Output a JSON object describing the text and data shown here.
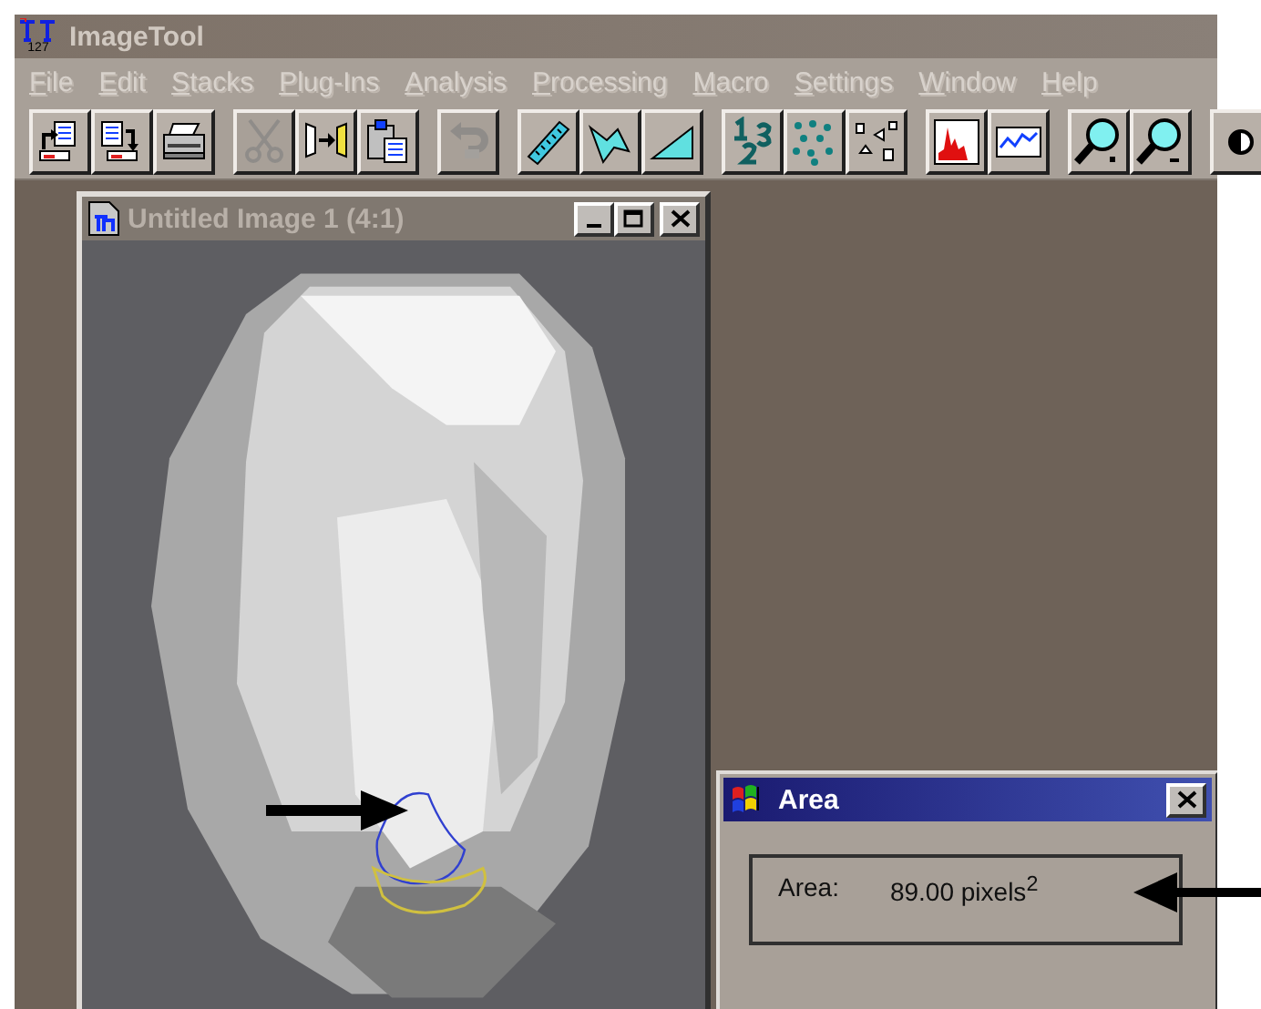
{
  "window": {
    "title": "ImageTool",
    "logo_text": "127"
  },
  "menu": [
    {
      "label": "File"
    },
    {
      "label": "Edit"
    },
    {
      "label": "Stacks"
    },
    {
      "label": "Plug-Ins"
    },
    {
      "label": "Analysis"
    },
    {
      "label": "Processing"
    },
    {
      "label": "Macro"
    },
    {
      "label": "Settings"
    },
    {
      "label": "Window"
    },
    {
      "label": "Help"
    }
  ],
  "toolbar": [
    [
      {
        "kind": "open",
        "disabled": false
      },
      {
        "kind": "save",
        "disabled": false
      },
      {
        "kind": "print",
        "disabled": false
      }
    ],
    [
      {
        "kind": "cut",
        "disabled": true
      },
      {
        "kind": "flip",
        "disabled": false
      },
      {
        "kind": "paste",
        "disabled": false
      }
    ],
    [
      {
        "kind": "undo",
        "disabled": true
      }
    ],
    [
      {
        "kind": "ruler",
        "disabled": false
      },
      {
        "kind": "polygon",
        "disabled": false
      },
      {
        "kind": "triangle",
        "disabled": false
      }
    ],
    [
      {
        "kind": "numbers",
        "disabled": false
      },
      {
        "kind": "dots",
        "disabled": false
      },
      {
        "kind": "particles",
        "disabled": false
      }
    ],
    [
      {
        "kind": "histogram",
        "disabled": false
      },
      {
        "kind": "profile",
        "disabled": false
      }
    ],
    [
      {
        "kind": "zoomin",
        "disabled": false
      },
      {
        "kind": "zoomout",
        "disabled": false
      }
    ],
    [
      {
        "kind": "contrast",
        "disabled": false
      }
    ]
  ],
  "image_window": {
    "title": "Untitled Image 1 (4:1)",
    "active": false
  },
  "area_dialog": {
    "title": "Area",
    "active": true,
    "label": "Area:",
    "value": "89.00 pixels$^{2}$"
  }
}
